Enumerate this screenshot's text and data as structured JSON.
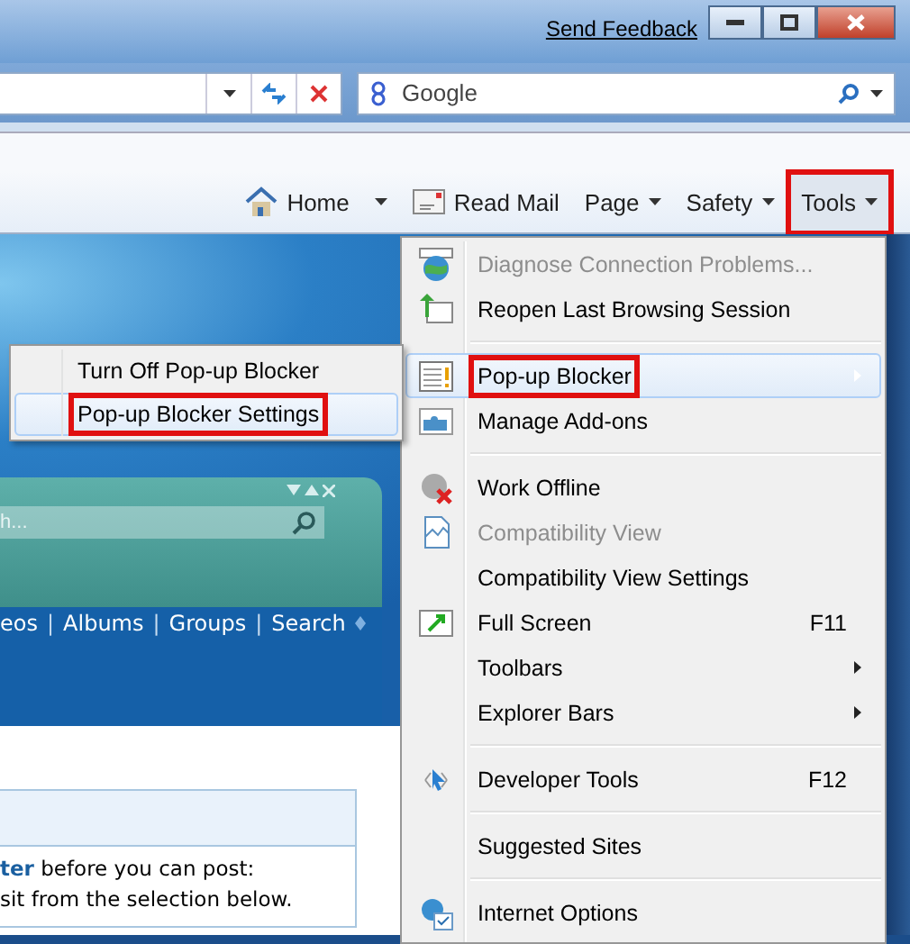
{
  "window": {
    "feedback_link": "Send Feedback"
  },
  "search": {
    "placeholder": "Google"
  },
  "command_bar": [
    {
      "label": "Home",
      "kind": "split",
      "highlighted": false
    },
    {
      "label": "Read Mail",
      "kind": "plain",
      "highlighted": false
    },
    {
      "label": "Page",
      "kind": "dropdown",
      "highlighted": false
    },
    {
      "label": "Safety",
      "kind": "dropdown",
      "highlighted": false
    },
    {
      "label": "Tools",
      "kind": "dropdown",
      "highlighted": true
    }
  ],
  "page": {
    "panel_search": {
      "placeholder": "h..."
    },
    "nav": [
      {
        "kind": "link",
        "text": "eos"
      },
      {
        "kind": "separator",
        "text": "|"
      },
      {
        "kind": "link",
        "text": "Albums"
      },
      {
        "kind": "separator",
        "text": "|"
      },
      {
        "kind": "link",
        "text": "Groups"
      },
      {
        "kind": "separator",
        "text": "|"
      },
      {
        "kind": "link",
        "text": "Search"
      }
    ],
    "notice": [
      "**ter** before you can post:",
      "sit from the selection below."
    ]
  },
  "submenu": {
    "items": [
      {
        "label": "Turn Off Pop-up Blocker",
        "selected": false,
        "highlighted": false
      },
      {
        "label": "Pop-up Blocker Settings",
        "selected": true,
        "highlighted": true
      }
    ]
  },
  "menu": {
    "items": [
      {
        "kind": "item",
        "label": "Diagnose Connection Problems...",
        "disabled": true,
        "selected": false,
        "highlighted": false
      },
      {
        "kind": "item",
        "label": "Reopen Last Browsing Session",
        "disabled": false,
        "selected": false,
        "highlighted": false
      },
      {
        "kind": "separator"
      },
      {
        "kind": "item",
        "label": "Pop-up Blocker",
        "disabled": false,
        "selected": true,
        "highlighted": true,
        "submenu": true
      },
      {
        "kind": "item",
        "label": "Manage Add-ons",
        "disabled": false,
        "selected": false,
        "highlighted": false
      },
      {
        "kind": "separator"
      },
      {
        "kind": "item",
        "label": "Work Offline",
        "disabled": false,
        "selected": false,
        "highlighted": false
      },
      {
        "kind": "item",
        "label": "Compatibility View",
        "disabled": true,
        "selected": false,
        "highlighted": false
      },
      {
        "kind": "item",
        "label": "Compatibility View Settings",
        "disabled": false,
        "selected": false,
        "highlighted": false
      },
      {
        "kind": "item",
        "label": "Full Screen",
        "shortcut": "F11",
        "disabled": false,
        "selected": false,
        "highlighted": false
      },
      {
        "kind": "item",
        "label": "Toolbars",
        "disabled": false,
        "selected": false,
        "highlighted": false,
        "submenu": true
      },
      {
        "kind": "item",
        "label": "Explorer Bars",
        "disabled": false,
        "selected": false,
        "highlighted": false,
        "submenu": true
      },
      {
        "kind": "separator"
      },
      {
        "kind": "item",
        "label": "Developer Tools",
        "shortcut": "F12",
        "disabled": false,
        "selected": false,
        "highlighted": false
      },
      {
        "kind": "separator"
      },
      {
        "kind": "item",
        "label": "Suggested Sites",
        "disabled": false,
        "selected": false,
        "highlighted": false
      },
      {
        "kind": "separator"
      },
      {
        "kind": "item",
        "label": "Internet Options",
        "disabled": false,
        "selected": false,
        "highlighted": false
      }
    ]
  }
}
